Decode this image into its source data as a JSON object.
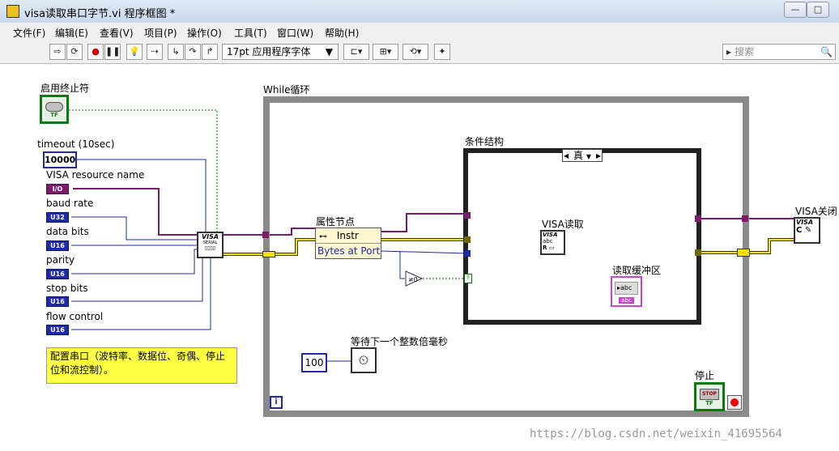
{
  "window": {
    "title": "visa读取串口字节.vi 程序框图 *"
  },
  "menu": [
    "文件(F)",
    "编辑(E)",
    "查看(V)",
    "项目(P)",
    "操作(O)",
    "工具(T)",
    "窗口(W)",
    "帮助(H)"
  ],
  "toolbar": {
    "font": "17pt 应用程序字体",
    "search_placeholder": "搜索"
  },
  "diagram": {
    "enable_term_label": "启用终止符",
    "timeout_label": "timeout (10sec)",
    "timeout_value": "10000",
    "resource_label": "VISA resource name",
    "resource_type": "I/O",
    "baud_label": "baud rate",
    "baud_type": "U32",
    "databits_label": "data bits",
    "databits_type": "U16",
    "parity_label": "parity",
    "parity_type": "U16",
    "stopbits_label": "stop bits",
    "stopbits_type": "U16",
    "flow_label": "flow control",
    "flow_type": "U16",
    "while_label": "While循环",
    "property_node_label": "属性节点",
    "property_node_class": "Instr",
    "property_node_prop": "Bytes at Port",
    "case_label": "条件结构",
    "case_selector": "真",
    "visa_read_label": "VISA读取",
    "buffer_label": "读取缓冲区",
    "visa_close_label": "VISA关闭",
    "wait_label": "等待下一个整数倍毫秒",
    "wait_value": "100",
    "stop_label": "停止",
    "comment": "配置串口（波特率、数据位、奇偶、停止位和流控制）。",
    "watermark": "https://blog.csdn.net/weixin_41695564"
  }
}
